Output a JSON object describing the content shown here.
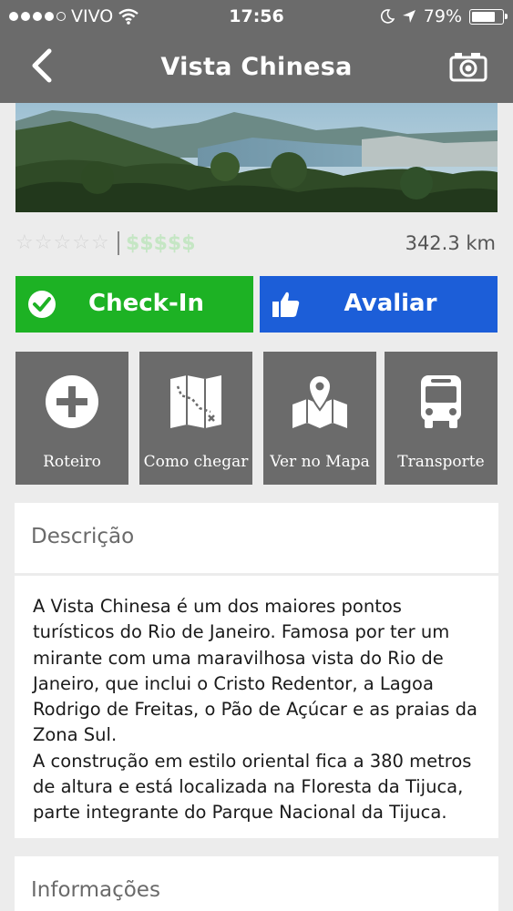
{
  "statusbar": {
    "carrier": "VIVO",
    "time": "17:56",
    "battery": "79%",
    "battery_level": 0.79
  },
  "navbar": {
    "title": "Vista Chinesa",
    "back_icon": "chevron-left-icon",
    "camera_icon": "camera-icon"
  },
  "hero": {
    "image": "panoramic view of Rio de Janeiro with lagoon and hills"
  },
  "rating": {
    "stars_filled": 0,
    "stars_total": 5,
    "price": "$$$$$",
    "distance": "342.3 km"
  },
  "actions": {
    "checkin": "Check-In",
    "avaliar": "Avaliar"
  },
  "tiles": [
    {
      "label": "Roteiro",
      "icon": "plus-circle-icon"
    },
    {
      "label": "Como chegar",
      "icon": "route-map-icon"
    },
    {
      "label": "Ver no Mapa",
      "icon": "map-pin-icon"
    },
    {
      "label": "Transporte",
      "icon": "bus-icon"
    }
  ],
  "description": {
    "heading": "Descrição",
    "paragraphs": [
      "A Vista Chinesa é um dos maiores pontos turísticos do Rio de Janeiro. Famosa por ter um mirante com uma maravilhosa vista do Rio de Janeiro, que inclui o Cristo Redentor, a Lagoa Rodrigo de Freitas, o Pão de Açúcar e as praias da Zona Sul.",
      "A construção em estilo oriental fica a 380 metros de altura e está localizada na Floresta da Tijuca, parte integrante do Parque Nacional da Tijuca."
    ]
  },
  "info": {
    "heading": "Informações"
  },
  "colors": {
    "bar": "#6b6b6b",
    "checkin": "#1db224",
    "avaliar": "#1c5ed8",
    "price": "#c5e6c4"
  }
}
